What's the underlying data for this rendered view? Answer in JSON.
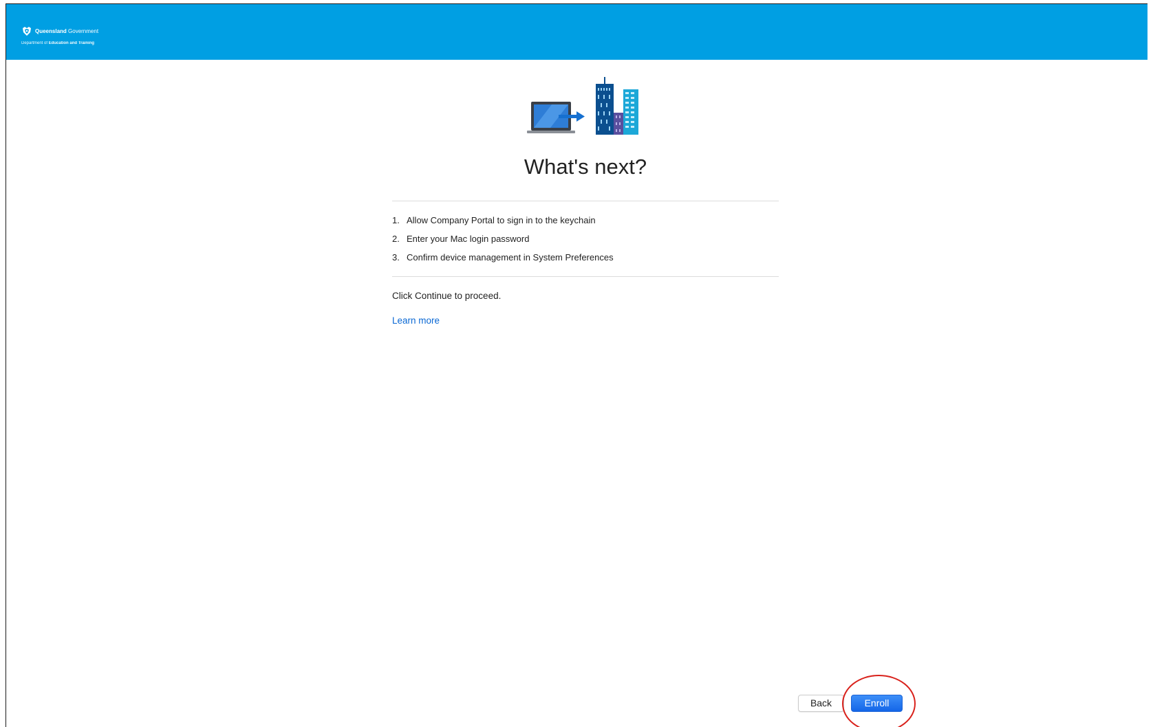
{
  "header": {
    "brand_name_bold": "Queensland",
    "brand_name_rest": " Government",
    "dept_prefix": "Department of ",
    "dept_bold": "Education and Training",
    "bar_color": "#009fe3",
    "logo_icon": "queensland-crest"
  },
  "main": {
    "illustration_icon": "laptop-to-buildings-illustration",
    "title": "What's next?",
    "steps": [
      {
        "num": "1.",
        "text": "Allow Company Portal to sign in to the keychain"
      },
      {
        "num": "2.",
        "text": "Enter your Mac login password"
      },
      {
        "num": "3.",
        "text": "Confirm device management in System Preferences"
      }
    ],
    "instruction": "Click Continue to proceed.",
    "learn_more": "Learn more"
  },
  "footer": {
    "back_label": "Back",
    "enroll_label": "Enroll",
    "accent_color": "#1466e8",
    "annotation_color": "#d9221c"
  }
}
